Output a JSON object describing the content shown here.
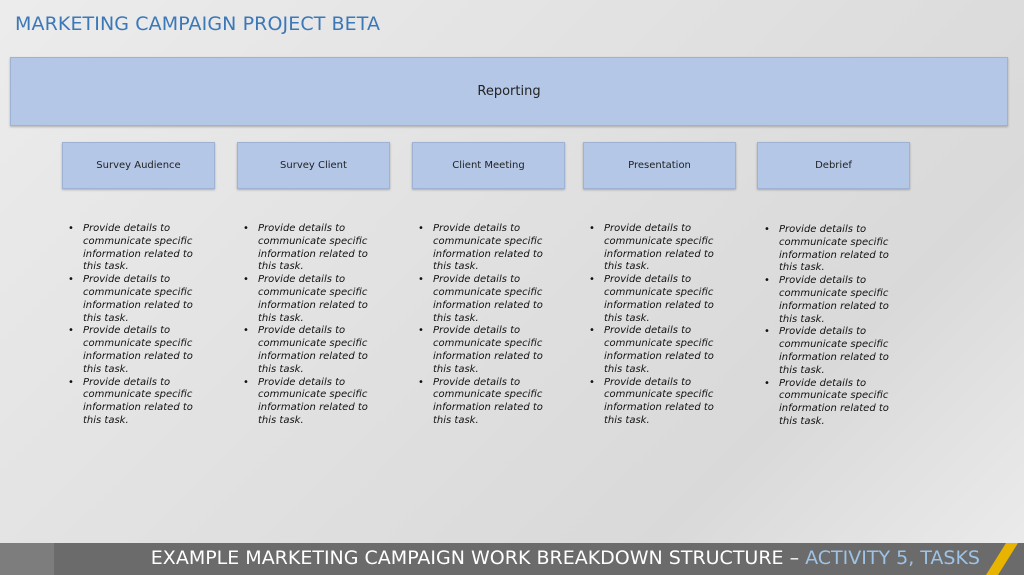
{
  "title": "MARKETING CAMPAIGN PROJECT BETA",
  "parent": {
    "label": "Reporting"
  },
  "tasks": [
    {
      "label": "Survey Audience",
      "details": [
        "Provide details to communicate specific information related to this task.",
        "Provide details to communicate specific information related to this task.",
        "Provide details to communicate specific information related to this task.",
        "Provide details to communicate specific information related to this task."
      ]
    },
    {
      "label": "Survey Client",
      "details": [
        "Provide details to communicate specific information related to this task.",
        "Provide details to communicate specific information related to this task.",
        "Provide details to communicate specific information related to this task.",
        "Provide details to communicate specific information related to this task."
      ]
    },
    {
      "label": "Client Meeting",
      "details": [
        "Provide details to communicate specific information related to this task.",
        "Provide details to communicate specific information related to this task.",
        "Provide details to communicate specific information related to this task.",
        "Provide details to communicate specific information related to this task."
      ]
    },
    {
      "label": "Presentation",
      "details": [
        "Provide details to communicate specific information related to this task.",
        "Provide details to communicate specific information related to this task.",
        "Provide details to communicate specific information related to this task.",
        "Provide details to communicate specific information related to this task."
      ]
    },
    {
      "label": "Debrief",
      "details": [
        "Provide details to communicate specific information related to this task.",
        "Provide details to communicate specific information related to this task.",
        "Provide details to communicate specific information related to this task.",
        "Provide details to communicate specific information related to this task."
      ]
    }
  ],
  "footer": {
    "main": "EXAMPLE MARKETING CAMPAIGN WORK BREAKDOWN STRUCTURE – ",
    "accent": "ACTIVITY 5, TASKS"
  },
  "colors": {
    "title": "#3b78b8",
    "box_fill": "#b4c7e7",
    "footer_bar": "#6b6b6b",
    "footer_accent": "#9dc3e6",
    "corner_stripe": "#e8b400"
  }
}
